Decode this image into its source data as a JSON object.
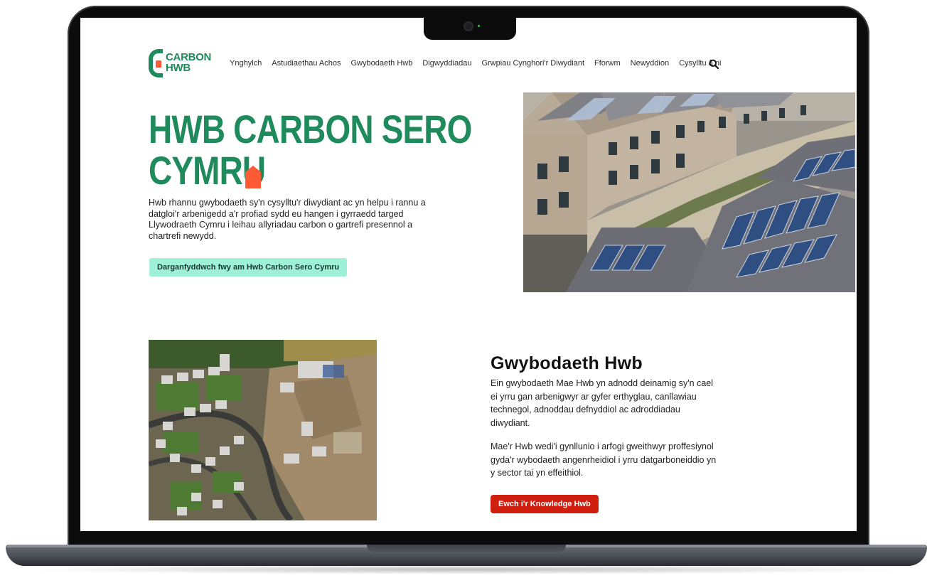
{
  "logo": {
    "line1": "CARBON",
    "line2": "HWB"
  },
  "nav": {
    "items": [
      "Ynghylch",
      "Astudiaethau Achos",
      "Gwybodaeth Hwb",
      "Digwyddiadau",
      "Grwpiau Cynghori'r Diwydiant",
      "Fforwm",
      "Newyddion",
      "Cysylltu â ni"
    ],
    "search_icon": "search-icon"
  },
  "hero": {
    "title_line1": "HWB CARBON SERO",
    "title_line2": "CYMRU",
    "text": "Hwb rhannu gwybodaeth sy'n cysylltu'r diwydiant ac yn helpu i rannu a datgloi'r arbenigedd a'r profiad sydd eu hangen i gyrraedd targed Llywodraeth Cymru i leihau allyriadau carbon o gartrefi presennol a chartrefi newydd.",
    "button": "Darganfyddwch fwy am Hwb Carbon Sero Cymru"
  },
  "knowledge": {
    "title": "Gwybodaeth Hwb",
    "p1": "Ein gwybodaeth Mae Hwb yn adnodd deinamig sy'n cael ei yrru gan arbenigwyr ar gyfer erthyglau, canllawiau technegol, adnoddau defnyddiol ac adroddiadau diwydiant.",
    "p2": "Mae'r Hwb wedi'i gynllunio i arfogi gweithwyr proffesiynol gyda'r wybodaeth angenrheidiol i yrru datgarboneiddio yn y sector tai yn effeithiol.",
    "button": "Ewch i'r Knowledge Hwb"
  },
  "colors": {
    "brand_green": "#1f8a5b",
    "accent_orange": "#ff5a36",
    "mint_button": "#9ef0d6",
    "red_button": "#d11f0f"
  }
}
